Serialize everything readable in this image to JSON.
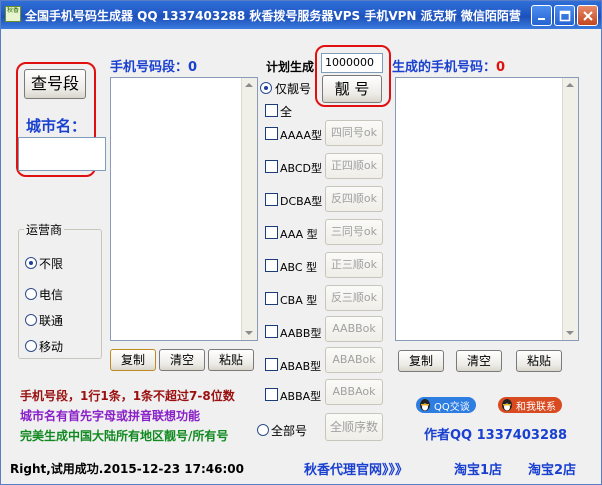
{
  "window": {
    "title": "全国手机号码生成器 QQ 1337403288 秋香拨号服务器VPS 手机VPN 派克斯 微信陌陌营销",
    "icon_text": "秋香"
  },
  "left": {
    "lookup_button": "查号段",
    "city_label": "城市名：",
    "city_value": "",
    "carrier_group_title": "运营商",
    "carriers": [
      "不限",
      "电信",
      "联通",
      "移动"
    ],
    "carrier_selected": 0
  },
  "segments": {
    "title": "手机号码段：",
    "count": "0",
    "copy": "复制",
    "clear": "清空",
    "paste": "粘贴"
  },
  "middle": {
    "plan_label": "计划生成",
    "plan_value": "1000000",
    "pretty_button": "靓 号",
    "only_pretty": "仅靓号",
    "all": "全",
    "patterns": [
      {
        "type": "AAAA型",
        "ok": "四同号ok"
      },
      {
        "type": "ABCD型",
        "ok": "正四顺ok"
      },
      {
        "type": "DCBA型",
        "ok": "反四顺ok"
      },
      {
        "type": "AAA 型",
        "ok": "三同号ok"
      },
      {
        "type": "ABC 型",
        "ok": "正三顺ok"
      },
      {
        "type": "CBA 型",
        "ok": "反三顺ok"
      },
      {
        "type": "AABB型",
        "ok": "AABBok"
      },
      {
        "type": "ABAB型",
        "ok": "ABABok"
      },
      {
        "type": "ABBA型",
        "ok": "ABBAok"
      }
    ],
    "all_numbers": "全部号",
    "all_sequence": "全顺序数"
  },
  "generated": {
    "title": "生成的手机号码：",
    "count": "0",
    "copy": "复制",
    "clear": "清空",
    "paste": "粘贴"
  },
  "notes": {
    "line1": "手机号段，1行1条，1条不超过7-8位数",
    "line2": "城市名有首先字母或拼音联想功能",
    "line3": "完美生成中国大陆所有地区靓号/所有号"
  },
  "contact": {
    "qq_badge": "QQ交谈",
    "contact_badge": "和我联系",
    "author": "作者QQ 1337403288"
  },
  "status": {
    "message": "Right,试用成功.2015-12-23 17:46:00",
    "link_site": "秋香代理官网》》》",
    "link_shop1": "淘宝1店",
    "link_shop2": "淘宝2店"
  },
  "colors": {
    "title_blue": "#2158c5",
    "label_blue": "#1a40d0",
    "red": "#e01010",
    "dark_red": "#9a1010",
    "purple": "#8a20c8",
    "green": "#108a20"
  }
}
